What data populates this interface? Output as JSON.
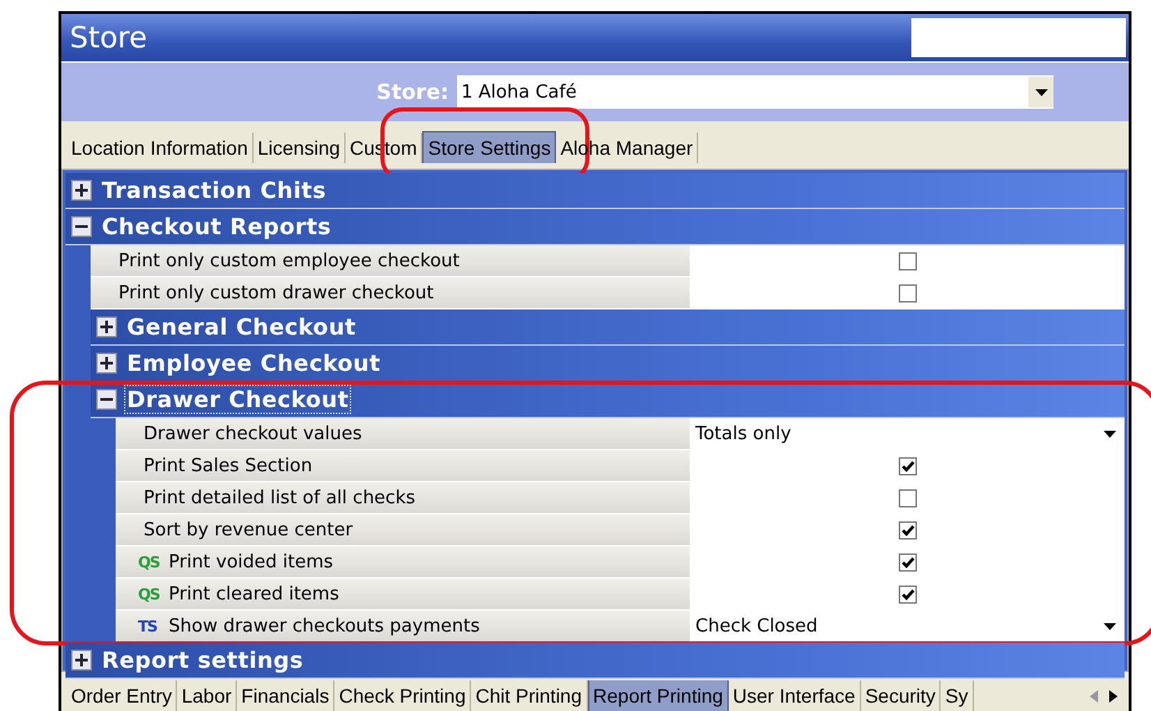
{
  "window": {
    "title": "Store"
  },
  "store": {
    "label": "Store:",
    "value": "1 Aloha Café"
  },
  "top_tabs": [
    {
      "label": "Location Information",
      "selected": false,
      "highlight": false
    },
    {
      "label": "Licensing",
      "selected": false,
      "highlight": false
    },
    {
      "label": "Custom",
      "selected": false,
      "highlight": false
    },
    {
      "label": "Store Settings",
      "selected": true,
      "highlight": true
    },
    {
      "label": "Aloha Manager",
      "selected": false,
      "highlight": false
    }
  ],
  "tree": [
    {
      "kind": "group",
      "label": "Transaction Chits",
      "expanded": false
    },
    {
      "kind": "group",
      "label": "Checkout Reports",
      "expanded": true,
      "children": [
        {
          "kind": "checkbox",
          "label": "Print only custom employee checkout",
          "checked": false
        },
        {
          "kind": "checkbox",
          "label": "Print only custom drawer checkout",
          "checked": false
        },
        {
          "kind": "group",
          "label": "General Checkout",
          "expanded": false
        },
        {
          "kind": "group",
          "label": "Employee Checkout",
          "expanded": false
        },
        {
          "kind": "group",
          "label": "Drawer Checkout",
          "expanded": true,
          "focused": true,
          "highlight": true,
          "children": [
            {
              "kind": "dropdown",
              "label": "Drawer checkout values",
              "value": "Totals only"
            },
            {
              "kind": "checkbox",
              "label": "Print Sales Section",
              "checked": true
            },
            {
              "kind": "checkbox",
              "label": "Print detailed list of all checks",
              "checked": false
            },
            {
              "kind": "checkbox",
              "label": "Sort by revenue center",
              "checked": true
            },
            {
              "kind": "checkbox",
              "label": "Print voided items",
              "checked": true,
              "badge": {
                "text": "QS",
                "color": "#2e9e3a"
              }
            },
            {
              "kind": "checkbox",
              "label": "Print cleared items",
              "checked": true,
              "badge": {
                "text": "QS",
                "color": "#2e9e3a"
              }
            },
            {
              "kind": "dropdown",
              "label": "Show drawer checkouts payments",
              "value": "Check Closed",
              "badge": {
                "text": "TS",
                "color": "#2146b8"
              }
            }
          ]
        }
      ]
    },
    {
      "kind": "group",
      "label": "Report settings",
      "expanded": false
    }
  ],
  "bottom_tabs": [
    {
      "label": "Order Entry",
      "selected": false
    },
    {
      "label": "Labor",
      "selected": false
    },
    {
      "label": "Financials",
      "selected": false
    },
    {
      "label": "Check Printing",
      "selected": false
    },
    {
      "label": "Chit Printing",
      "selected": false
    },
    {
      "label": "Report Printing",
      "selected": true
    },
    {
      "label": "User Interface",
      "selected": false
    },
    {
      "label": "Security",
      "selected": false
    },
    {
      "label": "Sy",
      "selected": false
    }
  ]
}
